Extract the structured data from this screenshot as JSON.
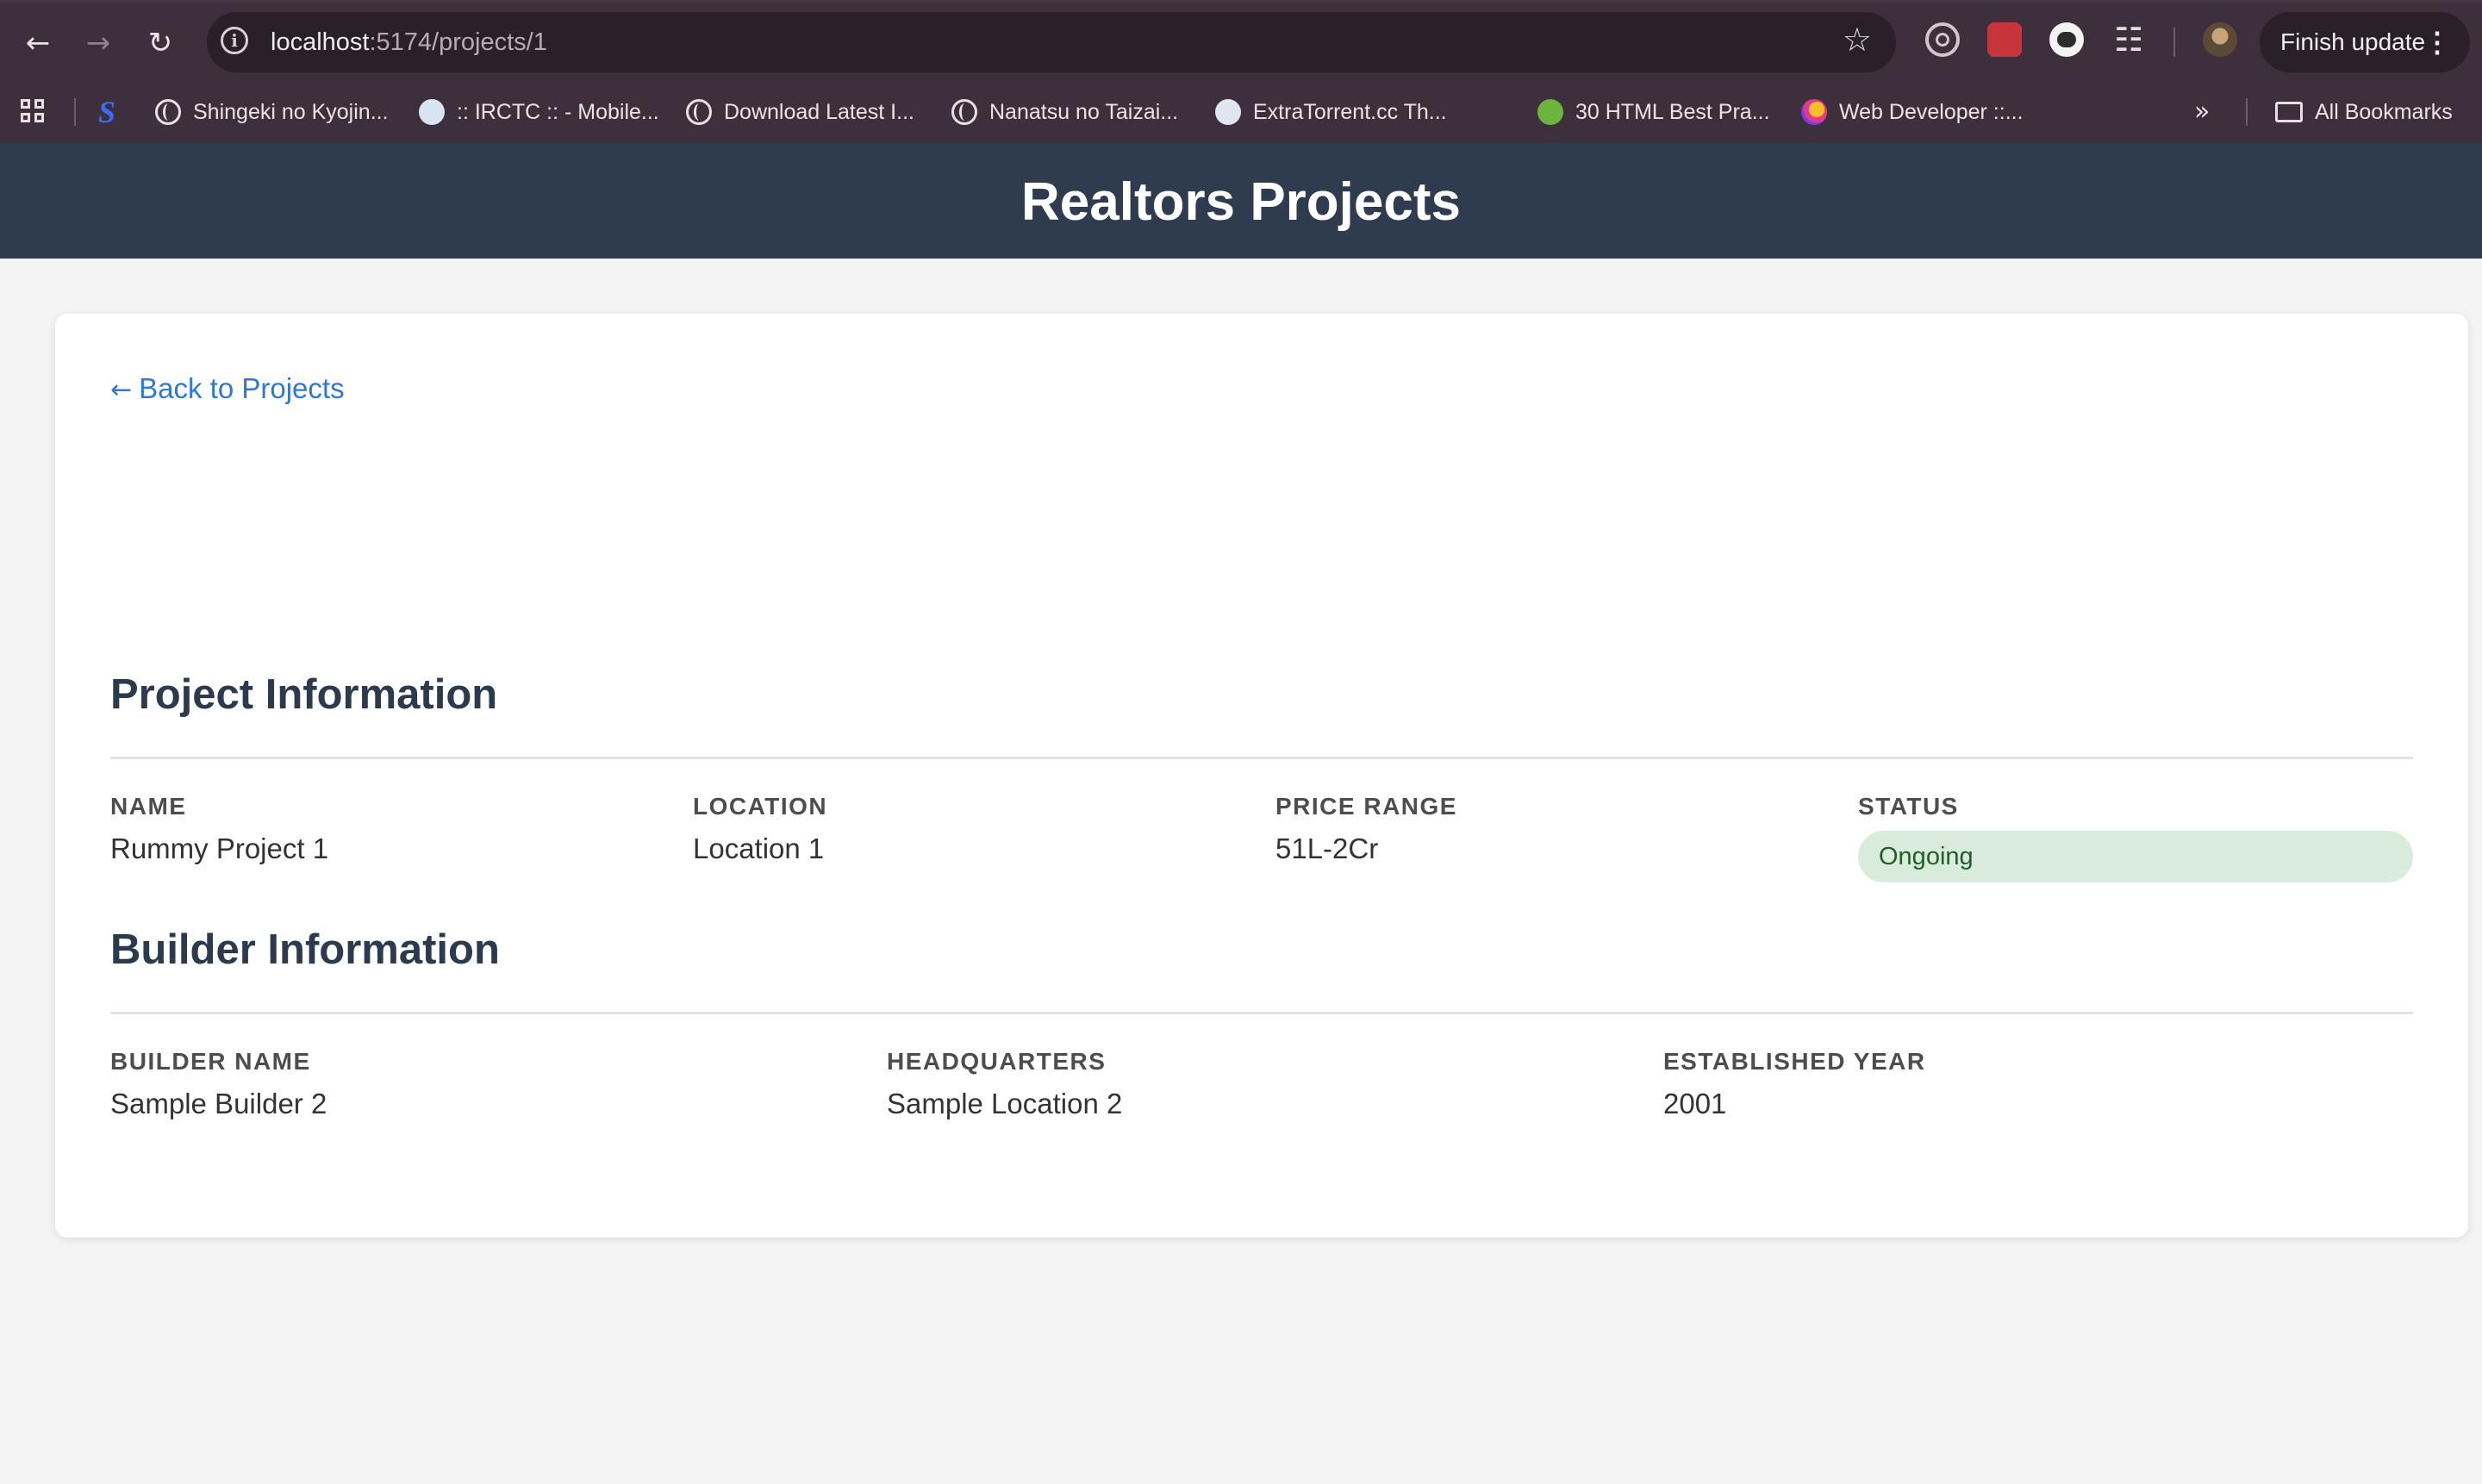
{
  "browser": {
    "url_host": "localhost",
    "url_path": ":5174/projects/1",
    "finish_update_label": "Finish update",
    "bookmarks": [
      {
        "label": "Shingeki no Kyojin..."
      },
      {
        "label": ":: IRCTC :: - Mobile..."
      },
      {
        "label": "Download Latest I..."
      },
      {
        "label": "Nanatsu no Taizai..."
      },
      {
        "label": "ExtraTorrent.cc Th..."
      },
      {
        "label": "30 HTML Best Pra..."
      },
      {
        "label": "Web Developer ::..."
      }
    ],
    "all_bookmarks_label": "All Bookmarks"
  },
  "app": {
    "title": "Realtors Projects",
    "back_link": "Back to Projects",
    "project_section": {
      "title": "Project Information",
      "fields": [
        {
          "label": "NAME",
          "value": "Rummy Project 1"
        },
        {
          "label": "LOCATION",
          "value": "Location 1"
        },
        {
          "label": "PRICE RANGE",
          "value": "51L-2Cr"
        },
        {
          "label": "STATUS",
          "value": "Ongoing"
        }
      ]
    },
    "builder_section": {
      "title": "Builder Information",
      "fields": [
        {
          "label": "BUILDER NAME",
          "value": "Sample Builder 2"
        },
        {
          "label": "HEADQUARTERS",
          "value": "Sample Location 2"
        },
        {
          "label": "ESTABLISHED YEAR",
          "value": "2001"
        }
      ]
    },
    "colors": {
      "header_bg": "#2f3c4f",
      "link": "#2f78d6",
      "status_bg": "#d9ecdb",
      "status_text": "#1f5d2a"
    }
  }
}
